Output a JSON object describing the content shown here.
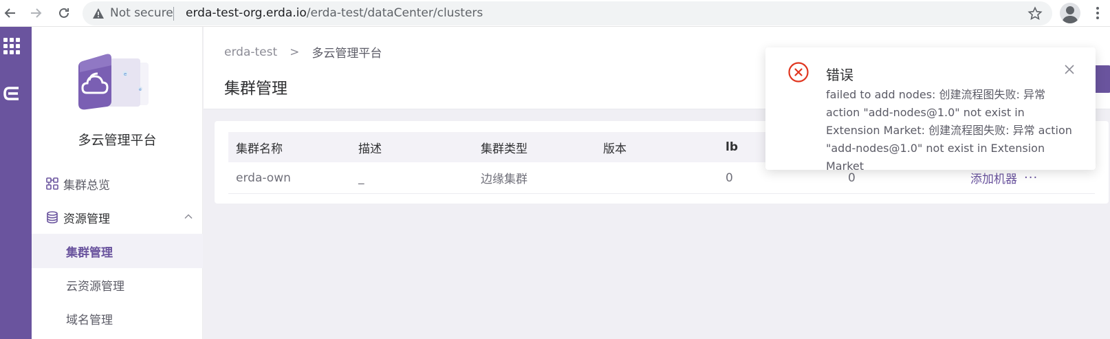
{
  "browser": {
    "security_label": "Not secure",
    "url_host": "erda-test-org.erda.io",
    "url_path": "/erda-test/dataCenter/clusters"
  },
  "sidebar": {
    "platform_name": "多云管理平台",
    "items": [
      {
        "label": "集群总览",
        "icon": "cluster-overview-icon"
      },
      {
        "label": "资源管理",
        "icon": "database-icon"
      },
      {
        "label": "集群管理"
      },
      {
        "label": "云资源管理"
      },
      {
        "label": "域名管理"
      }
    ]
  },
  "breadcrumb": {
    "root": "erda-test",
    "separator": ">",
    "current": "多云管理平台"
  },
  "page": {
    "title": "集群管理"
  },
  "table": {
    "columns": [
      "集群名称",
      "描述",
      "集群类型",
      "版本",
      "lb",
      "",
      ""
    ],
    "rows": [
      {
        "name": "erda-own",
        "desc": "_",
        "type": "边缘集群",
        "version": "",
        "lb": "0",
        "col6": "0",
        "action": "添加机器",
        "more": "···"
      }
    ]
  },
  "notification": {
    "title": "错误",
    "message": "failed to add nodes: 创建流程图失败: 异常 action \"add-nodes@1.0\" not exist in Extension Market: 创建流程图失败: 异常 action \"add-nodes@1.0\" not exist in Extension Market"
  },
  "colors": {
    "brand": "#6a549e",
    "error": "#e0361f"
  }
}
